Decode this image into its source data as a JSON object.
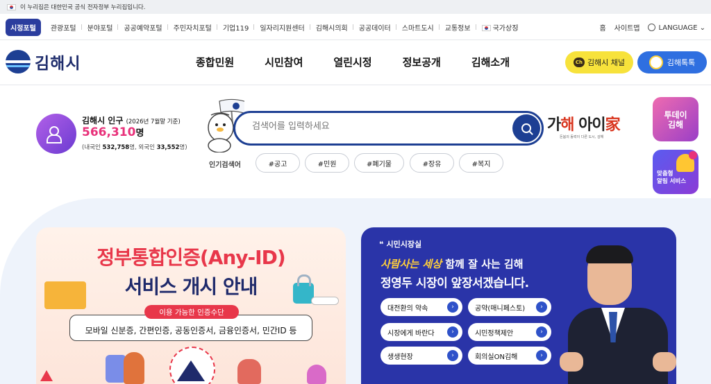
{
  "gov_notice": "이 누리집은 대한민국 공식 전자정부 누리집입니다.",
  "topnav": {
    "active": "시정포털",
    "links": [
      "관광포털",
      "분야포털",
      "공공예약포털",
      "주민자치포털",
      "기업119",
      "일자리지원센터",
      "김해시의회",
      "공공데이터",
      "스마트도시",
      "교통정보",
      "국가상징"
    ],
    "home": "홈",
    "sitemap": "사이트맵",
    "language": "LANGUAGE"
  },
  "header": {
    "logo_text": "김해시",
    "menu": [
      "종합민원",
      "시민참여",
      "열린시정",
      "정보공개",
      "김해소개"
    ],
    "channel_label": "김해시 채널",
    "channel_icon_text": "Ch",
    "talk_label": "김해톡톡"
  },
  "population": {
    "title": "김해시 인구",
    "date": "(2026년 7월말 기준)",
    "count": "566,310",
    "unit": "명",
    "sub_native_label": "(내국인 ",
    "sub_native": "532,758",
    "sub_foreign_label": "명, 외국인 ",
    "sub_foreign": "33,552",
    "sub_end": "명)"
  },
  "search": {
    "placeholder": "검색어를 입력하세요",
    "popular_label": "인기검색어",
    "keywords": [
      "#공고",
      "#민원",
      "#폐기물",
      "#장유",
      "#복지"
    ]
  },
  "aie_logo": {
    "text_pre": "가",
    "text_h": "해",
    "text_post": " 아이",
    "text_home": "家",
    "subtitle": "돈봄의 동력이 다른 도시, 김해"
  },
  "side": {
    "today": [
      "투데이",
      "김해"
    ],
    "alarm": [
      "맞춤형",
      "알림 서비스"
    ],
    "top_arrow": "↑"
  },
  "banner_left": {
    "title1": "정부통합인증(Any-ID)",
    "title2": "서비스 개시 안내",
    "pill": "이용 가능한 인증수단",
    "methods": "모바일 신분증, 간편인증, 공동인증서, 금융인증서, 민간ID 등"
  },
  "banner_right": {
    "tag": "시민시장실",
    "tag_icon": "❝",
    "slogan_y": "사람사는 세상",
    "slogan_w": " 함께 잘 사는 김해",
    "headline": "정영두 시장이 앞장서겠습니다.",
    "buttons": [
      "대전환의 약속",
      "공약(매니페스토)",
      "시장에게 바란다",
      "시민정책제안",
      "생생현장",
      "회의실ON김해"
    ],
    "arrow": "›"
  },
  "colors": {
    "brand_navy": "#1d3f93",
    "accent_pink": "#e8317a",
    "banner_right_bg": "#2a34a8",
    "kakao_yellow": "#f7e23b"
  }
}
